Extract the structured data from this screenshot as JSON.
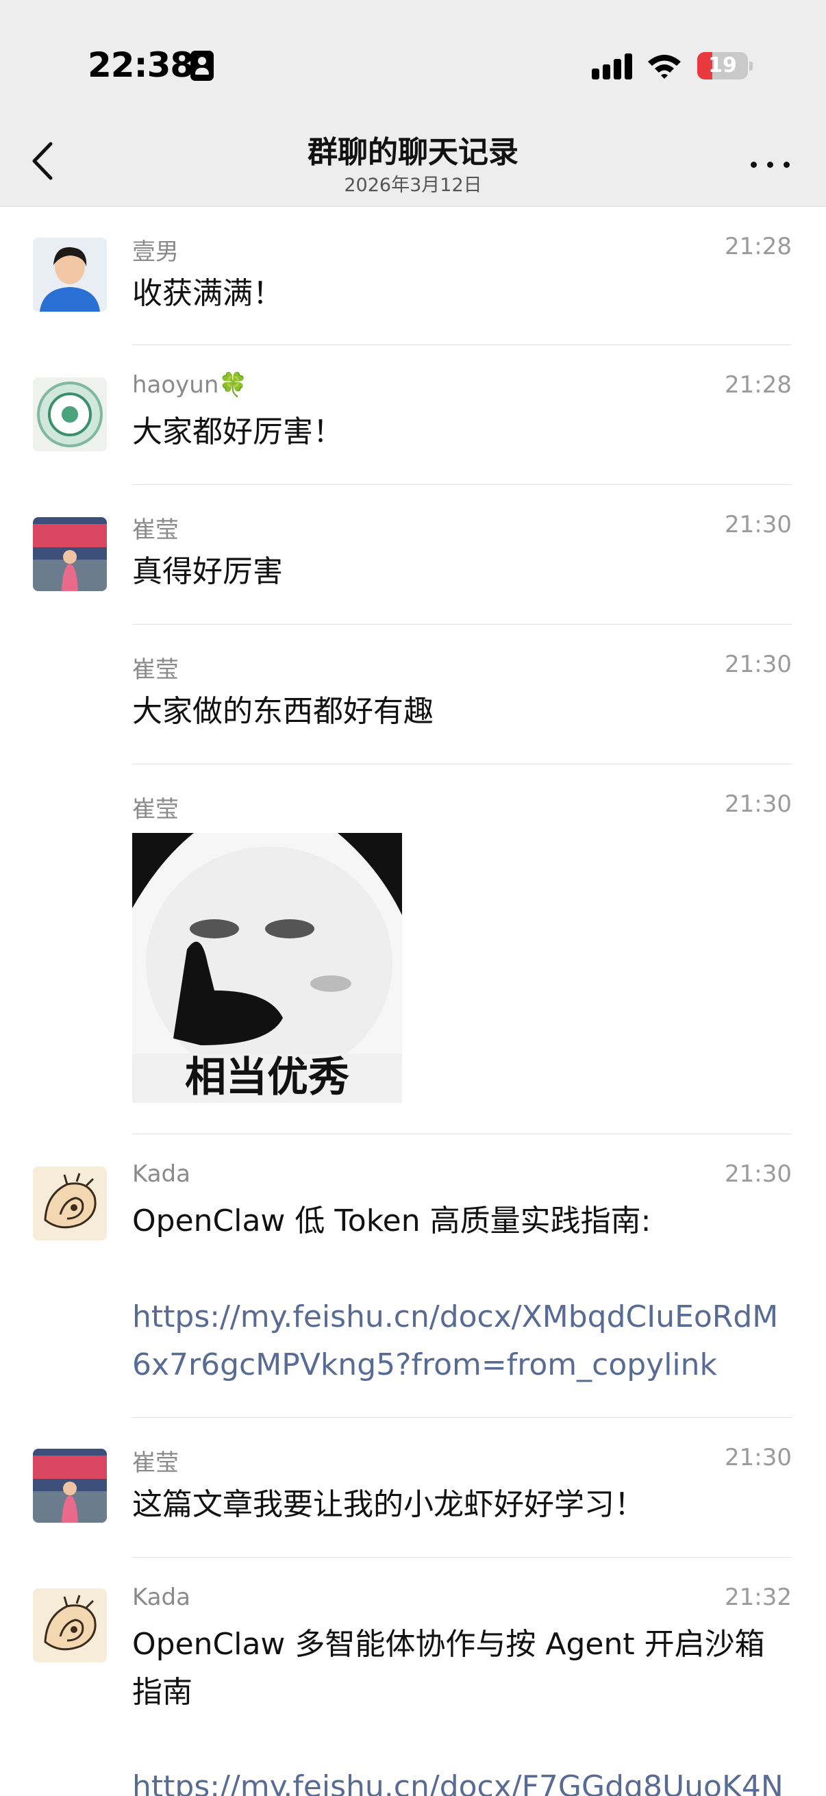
{
  "status_bar": {
    "time": "22:38",
    "battery_level": "19",
    "battery_color": "#e8393f"
  },
  "nav": {
    "title": "群聊的聊天记录",
    "subtitle": "2026年3月12日"
  },
  "messages": [
    {
      "sender": "壹男",
      "time": "21:28",
      "text": "收获满满！"
    },
    {
      "sender": "haoyun🍀",
      "time": "21:28",
      "text": "大家都好厉害！"
    },
    {
      "sender": "崔莹",
      "time": "21:30",
      "text": "真得好厉害"
    },
    {
      "sender": "崔莹",
      "time": "21:30",
      "text": "大家做的东西都好有趣"
    },
    {
      "sender": "崔莹",
      "time": "21:30",
      "sticker_caption": "相当优秀"
    },
    {
      "sender": "Kada",
      "time": "21:30",
      "text": "OpenClaw 低 Token 高质量实践指南:",
      "link": "https://my.feishu.cn/docx/XMbqdCIuEoRdM6x7r6gcMPVkng5?from=from_copylink"
    },
    {
      "sender": "崔莹",
      "time": "21:30",
      "text": "这篇文章我要让我的小龙虾好好学习！"
    },
    {
      "sender": "Kada",
      "time": "21:32",
      "text": "OpenClaw 多智能体协作与按 Agent 开启沙箱指南",
      "link": "https://my.feishu.cn/docx/F7GGdq8UuoK4N"
    }
  ]
}
